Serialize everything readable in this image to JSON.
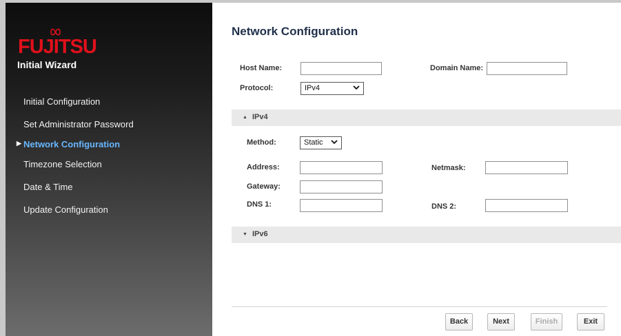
{
  "brand": {
    "logo_text": "FUJITSU",
    "wizard_title": "Initial Wizard",
    "logo_color": "#e0101b"
  },
  "nav": {
    "items": [
      {
        "label": "Initial Configuration",
        "active": false
      },
      {
        "label": "Set Administrator Password",
        "active": false
      },
      {
        "label": "Network Configuration",
        "active": true
      },
      {
        "label": "Timezone Selection",
        "active": false
      },
      {
        "label": "Date & Time",
        "active": false
      },
      {
        "label": "Update Configuration",
        "active": false
      }
    ],
    "active_color": "#68b7ff"
  },
  "page": {
    "title": "Network Configuration"
  },
  "form": {
    "host_name_label": "Host Name:",
    "host_name_value": "",
    "domain_name_label": "Domain Name:",
    "domain_name_value": "",
    "protocol_label": "Protocol:",
    "protocol_value": "IPv4",
    "ipv4_section": {
      "label": "IPv4",
      "expanded": true
    },
    "method_label": "Method:",
    "method_value": "Static",
    "address_label": "Address:",
    "address_value": "",
    "netmask_label": "Netmask:",
    "netmask_value": "",
    "gateway_label": "Gateway:",
    "gateway_value": "",
    "dns1_label": "DNS 1:",
    "dns1_value": "",
    "dns2_label": "DNS 2:",
    "dns2_value": "",
    "ipv6_section": {
      "label": "IPv6",
      "expanded": false
    }
  },
  "buttons": {
    "back": "Back",
    "next": "Next",
    "finish": "Finish",
    "exit": "Exit"
  }
}
